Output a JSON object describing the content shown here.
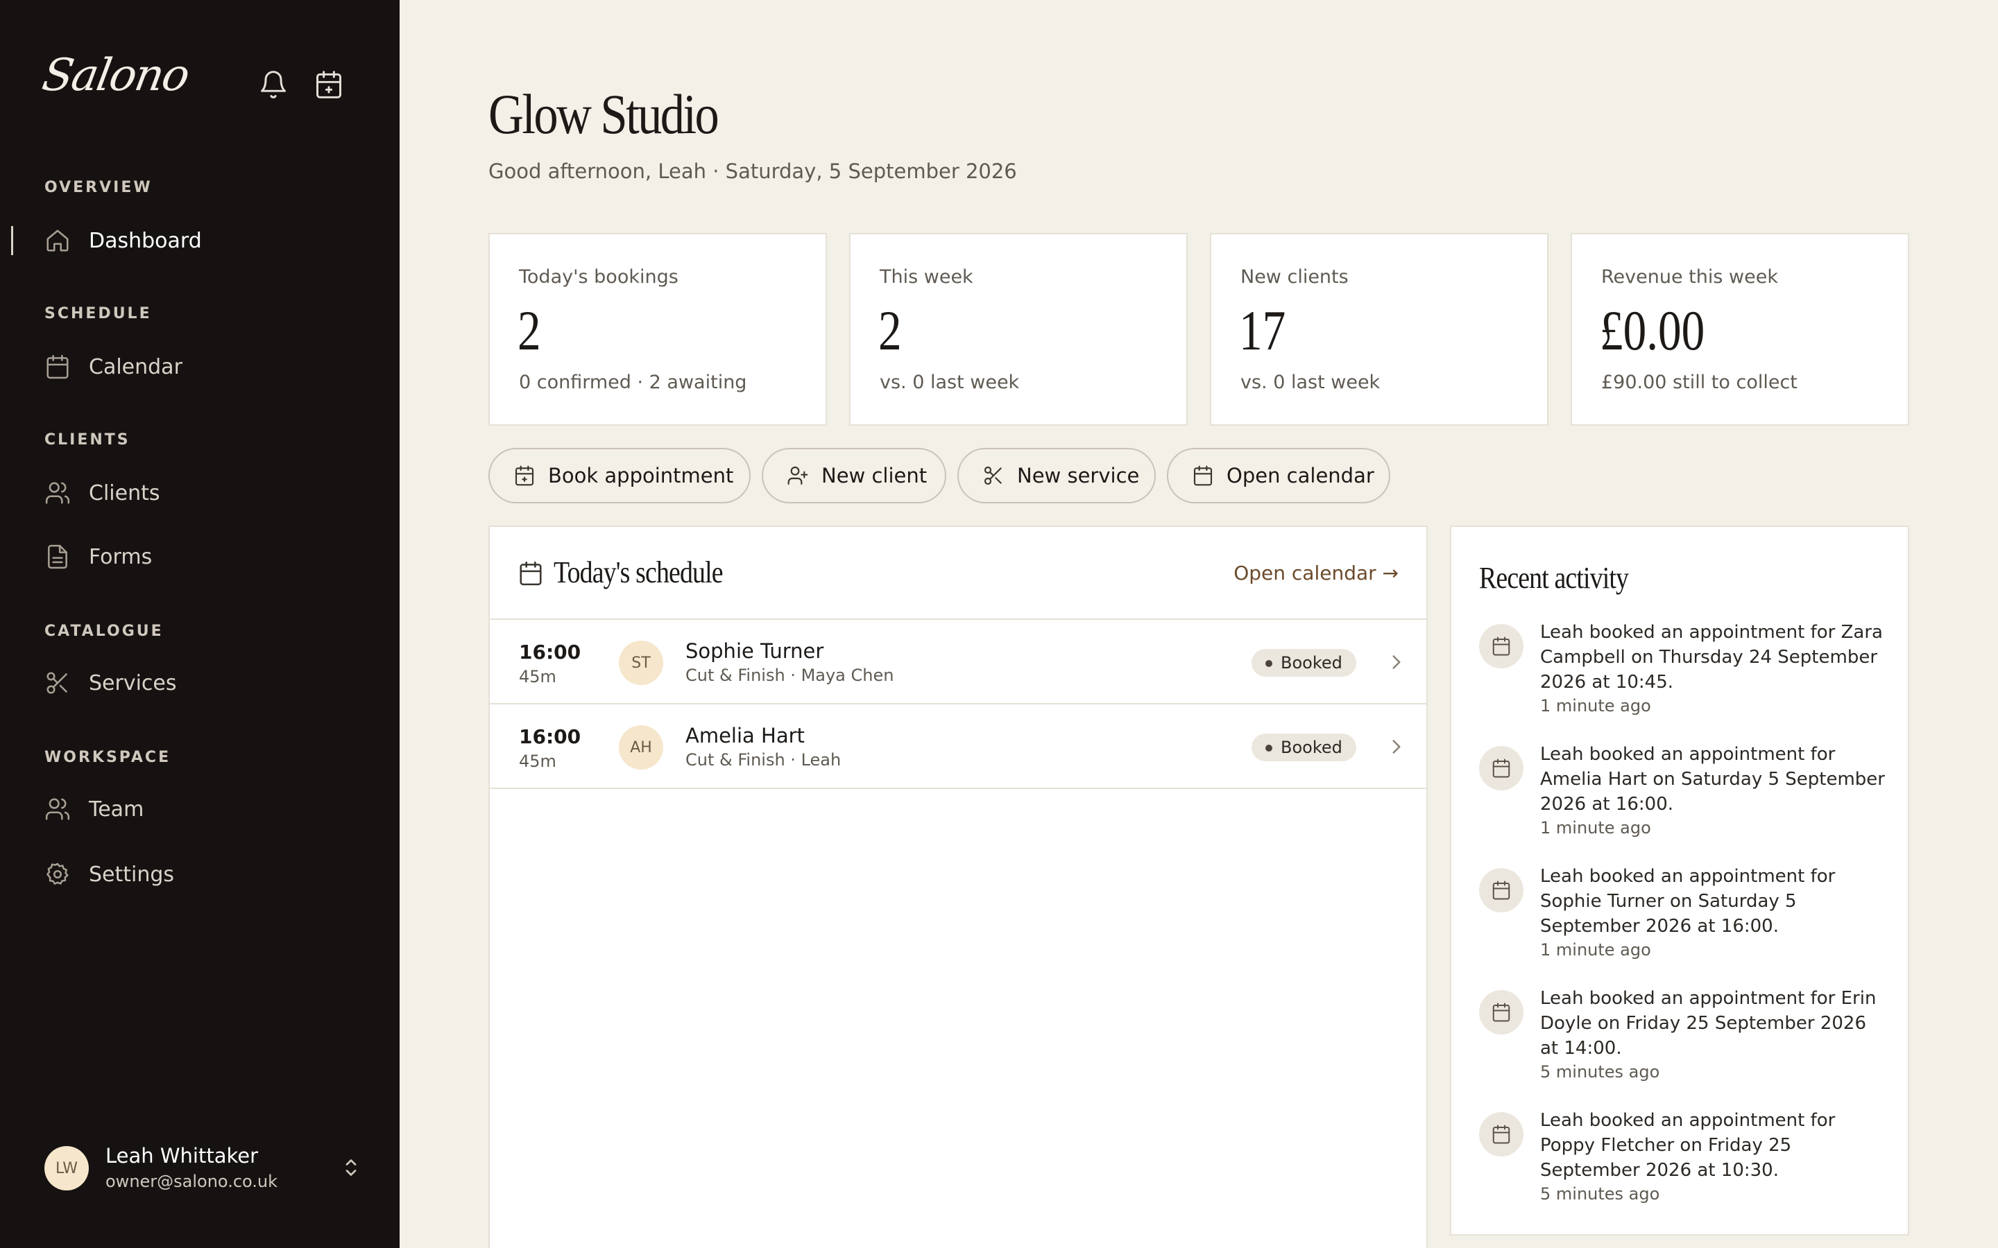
{
  "sidebar": {
    "brand": "Salono",
    "sections": [
      {
        "label": "OVERVIEW",
        "items": [
          {
            "label": "Dashboard",
            "icon": "home-icon",
            "active": true
          }
        ]
      },
      {
        "label": "SCHEDULE",
        "items": [
          {
            "label": "Calendar",
            "icon": "calendar-icon"
          }
        ]
      },
      {
        "label": "CLIENTS",
        "items": [
          {
            "label": "Clients",
            "icon": "users-icon"
          },
          {
            "label": "Forms",
            "icon": "file-icon"
          }
        ]
      },
      {
        "label": "CATALOGUE",
        "items": [
          {
            "label": "Services",
            "icon": "scissors-icon"
          }
        ]
      },
      {
        "label": "WORKSPACE",
        "items": [
          {
            "label": "Team",
            "icon": "users-icon"
          },
          {
            "label": "Settings",
            "icon": "gear-icon"
          }
        ]
      }
    ],
    "user": {
      "initials": "LW",
      "name": "Leah Whittaker",
      "email": "owner@salono.co.uk"
    }
  },
  "header": {
    "title": "Glow Studio",
    "subtitle": "Good afternoon, Leah · Saturday, 5 September 2026"
  },
  "stats": [
    {
      "label": "Today's bookings",
      "value": "2",
      "note": "0 confirmed · 2 awaiting"
    },
    {
      "label": "This week",
      "value": "2",
      "note": "vs. 0 last week"
    },
    {
      "label": "New clients",
      "value": "17",
      "note": "vs. 0 last week"
    },
    {
      "label": "Revenue this week",
      "value": "£0.00",
      "note": "£90.00 still to collect"
    }
  ],
  "actions": [
    {
      "label": "Book appointment",
      "icon": "calendar-plus-icon"
    },
    {
      "label": "New client",
      "icon": "user-plus-icon"
    },
    {
      "label": "New service",
      "icon": "scissors-icon"
    },
    {
      "label": "Open calendar",
      "icon": "calendar-icon"
    }
  ],
  "schedule": {
    "title": "Today's schedule",
    "link": "Open calendar →",
    "appointments": [
      {
        "time": "16:00",
        "duration": "45m",
        "initials": "ST",
        "client": "Sophie Turner",
        "service": "Cut & Finish",
        "staff": "Maya Chen",
        "status": "Booked"
      },
      {
        "time": "16:00",
        "duration": "45m",
        "initials": "AH",
        "client": "Amelia Hart",
        "service": "Cut & Finish",
        "staff": "Leah",
        "status": "Booked"
      }
    ]
  },
  "activity": {
    "title": "Recent activity",
    "items": [
      {
        "text": "Leah booked an appointment for Zara Campbell on Thursday 24 September 2026 at 10:45.",
        "time": "1 minute ago"
      },
      {
        "text": "Leah booked an appointment for Amelia Hart on Saturday 5 September 2026 at 16:00.",
        "time": "1 minute ago"
      },
      {
        "text": "Leah booked an appointment for Sophie Turner on Saturday 5 September 2026 at 16:00.",
        "time": "1 minute ago"
      },
      {
        "text": "Leah booked an appointment for Erin Doyle on Friday 25 September 2026 at 14:00.",
        "time": "5 minutes ago"
      },
      {
        "text": "Leah booked an appointment for Poppy Fletcher on Friday 25 September 2026 at 10:30.",
        "time": "5 minutes ago"
      }
    ]
  }
}
